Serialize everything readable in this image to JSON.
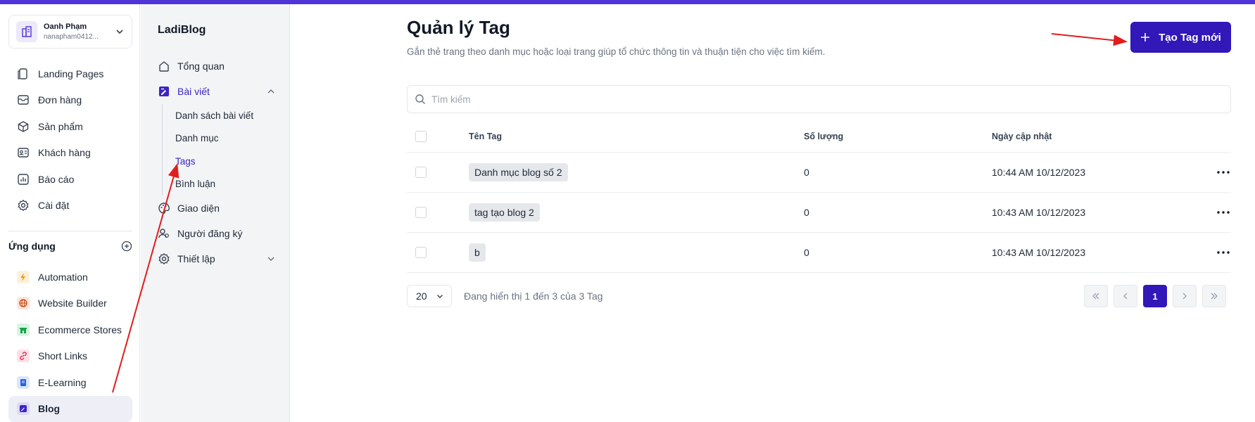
{
  "account": {
    "name": "Oanh Phạm",
    "email": "nanapham0412..."
  },
  "main_nav": [
    {
      "label": "Landing Pages",
      "icon": "pages-icon"
    },
    {
      "label": "Đơn hàng",
      "icon": "orders-icon"
    },
    {
      "label": "Sản phẩm",
      "icon": "box-icon"
    },
    {
      "label": "Khách hàng",
      "icon": "contact-card-icon"
    },
    {
      "label": "Báo cáo",
      "icon": "report-icon"
    },
    {
      "label": "Cài đặt",
      "icon": "gear-icon"
    }
  ],
  "apps": {
    "title": "Ứng dụng",
    "items": [
      {
        "label": "Automation",
        "icon": "bolt-icon",
        "color": "#f59e0b",
        "bg": "#fdf1dc"
      },
      {
        "label": "Website Builder",
        "icon": "globe-icon",
        "color": "#c2410c",
        "bg": "#fbe4d8"
      },
      {
        "label": "Ecommerce Stores",
        "icon": "store-icon",
        "color": "#16a34a",
        "bg": "#d7f4e1"
      },
      {
        "label": "Short Links",
        "icon": "link-icon",
        "color": "#e11d48",
        "bg": "#fde0e6"
      },
      {
        "label": "E-Learning",
        "icon": "book-icon",
        "color": "#2563eb",
        "bg": "#dbe6fd"
      },
      {
        "label": "Blog",
        "icon": "blog-icon",
        "color": "#3a25c4",
        "bg": "#dcd8f6",
        "active": true
      }
    ]
  },
  "sub_nav": {
    "title": "LadiBlog",
    "overview": "Tổng quan",
    "posts": "Bài viết",
    "children": [
      "Danh sách bài viết",
      "Danh mục",
      "Tags",
      "Bình luận"
    ],
    "active_child": "Tags",
    "theme": "Giao diện",
    "subscribers": "Người đăng ký",
    "settings": "Thiết lập"
  },
  "page": {
    "title": "Quản lý Tag",
    "subtitle": "Gắn thẻ trang theo danh mục hoặc loại trang giúp tổ chức thông tin và thuận tiện cho việc tìm kiếm.",
    "create_button": "Tạo Tag mới",
    "search_placeholder": "Tìm kiếm"
  },
  "table": {
    "columns": [
      "Tên Tag",
      "Số lượng",
      "Ngày cập nhật"
    ],
    "rows": [
      {
        "name": "Danh mục blog số 2",
        "qty": "0",
        "date": "10:44 AM 10/12/2023"
      },
      {
        "name": "tag tạo blog 2",
        "qty": "0",
        "date": "10:43 AM 10/12/2023"
      },
      {
        "name": "b",
        "qty": "0",
        "date": "10:43 AM 10/12/2023"
      }
    ]
  },
  "pagination": {
    "page_size": "20",
    "showing": "Đang hiển thị 1 đến 3 của 3 Tag",
    "current_page": "1"
  },
  "colors": {
    "accent": "#3217b9",
    "topbar": "#4f35d8",
    "annotation": "#e11d1d"
  }
}
